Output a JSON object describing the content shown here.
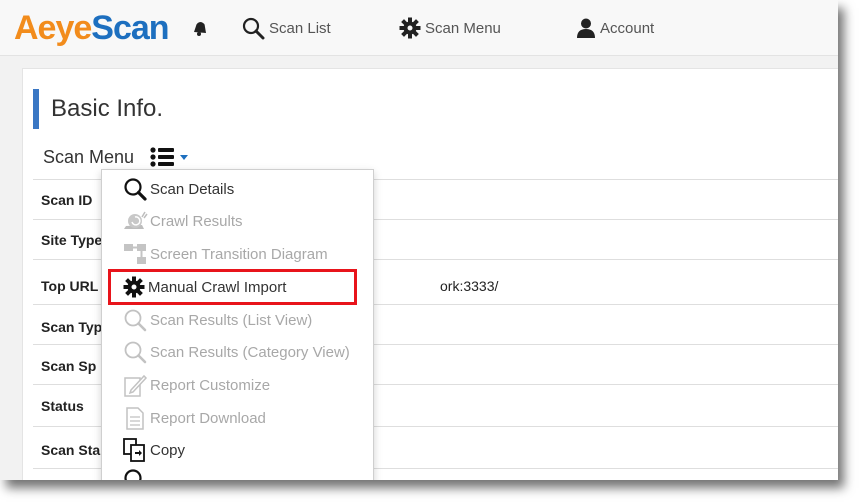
{
  "logo": {
    "part1": "Aeye",
    "part2": "Scan"
  },
  "nav": {
    "scan_list": "Scan List",
    "scan_menu": "Scan Menu",
    "account": "Account"
  },
  "page": {
    "title": "Basic Info.",
    "scan_menu_label": "Scan Menu"
  },
  "table": {
    "rows": [
      {
        "label": "Scan ID",
        "value": ""
      },
      {
        "label": "Site Type",
        "value": ""
      },
      {
        "label": "Top URL",
        "value": "ork:3333/"
      },
      {
        "label": "Scan Typ",
        "value": ""
      },
      {
        "label": "Scan Sp",
        "value": ""
      },
      {
        "label": "Status",
        "value": ""
      },
      {
        "label": "Scan Sta",
        "value": ""
      }
    ]
  },
  "dropdown": {
    "items": [
      {
        "label": "Scan Details",
        "enabled": true,
        "icon": "magnifier-icon"
      },
      {
        "label": "Crawl Results",
        "enabled": false,
        "icon": "snail-icon"
      },
      {
        "label": "Screen Transition Diagram",
        "enabled": false,
        "icon": "diagram-icon"
      },
      {
        "label": "Manual Crawl Import",
        "enabled": true,
        "icon": "gear-icon",
        "highlighted": true
      },
      {
        "label": "Scan Results (List View)",
        "enabled": false,
        "icon": "magnifier-icon"
      },
      {
        "label": "Scan Results (Category View)",
        "enabled": false,
        "icon": "magnifier-icon"
      },
      {
        "label": "Report Customize",
        "enabled": false,
        "icon": "pencil-document-icon"
      },
      {
        "label": "Report Download",
        "enabled": false,
        "icon": "document-icon"
      },
      {
        "label": "Copy",
        "enabled": true,
        "icon": "copy-icon"
      }
    ]
  },
  "colors": {
    "logo_orange": "#f28c1c",
    "logo_blue": "#1d6fbf",
    "accent_bar": "#3a77c4",
    "highlight_border": "#e8141b",
    "disabled_text": "#a8a8a8"
  }
}
